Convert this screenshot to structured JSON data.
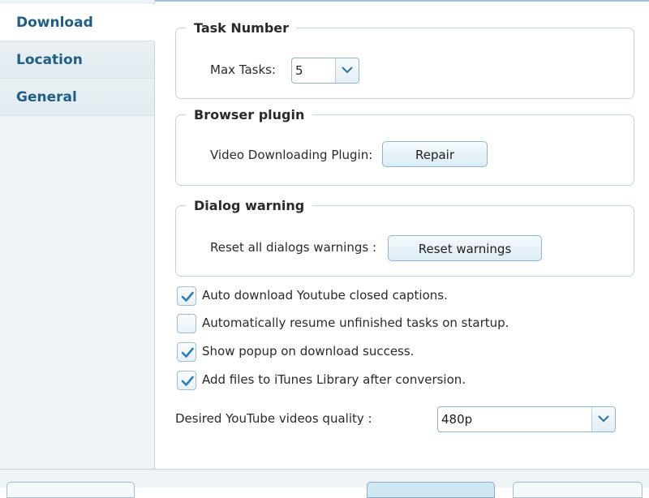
{
  "sidebar": {
    "items": [
      {
        "label": "Download",
        "active": true
      },
      {
        "label": "Location",
        "active": false
      },
      {
        "label": "General",
        "active": false
      }
    ]
  },
  "task_number": {
    "title": "Task Number",
    "max_tasks_label": "Max Tasks:",
    "max_tasks_value": "5"
  },
  "browser_plugin": {
    "title": "Browser plugin",
    "plugin_label": "Video Downloading Plugin:",
    "repair_label": "Repair"
  },
  "dialog_warning": {
    "title": "Dialog warning",
    "reset_label": "Reset all dialogs warnings :",
    "reset_button": "Reset warnings"
  },
  "options": [
    {
      "label": "Auto download Youtube closed captions.",
      "checked": true
    },
    {
      "label": "Automatically resume unfinished  tasks on startup.",
      "checked": false
    },
    {
      "label": "Show popup on download success.",
      "checked": true
    },
    {
      "label": "Add files to iTunes Library after conversion.",
      "checked": true
    }
  ],
  "quality": {
    "label": "Desired YouTube videos quality :",
    "value": "480p"
  },
  "colors": {
    "accent": "#1f5e86",
    "border": "#8eb6ce",
    "check": "#2b7fb8"
  },
  "icons": {
    "dropdown": "chevron-down-icon",
    "checkmark": "checkmark-icon"
  }
}
